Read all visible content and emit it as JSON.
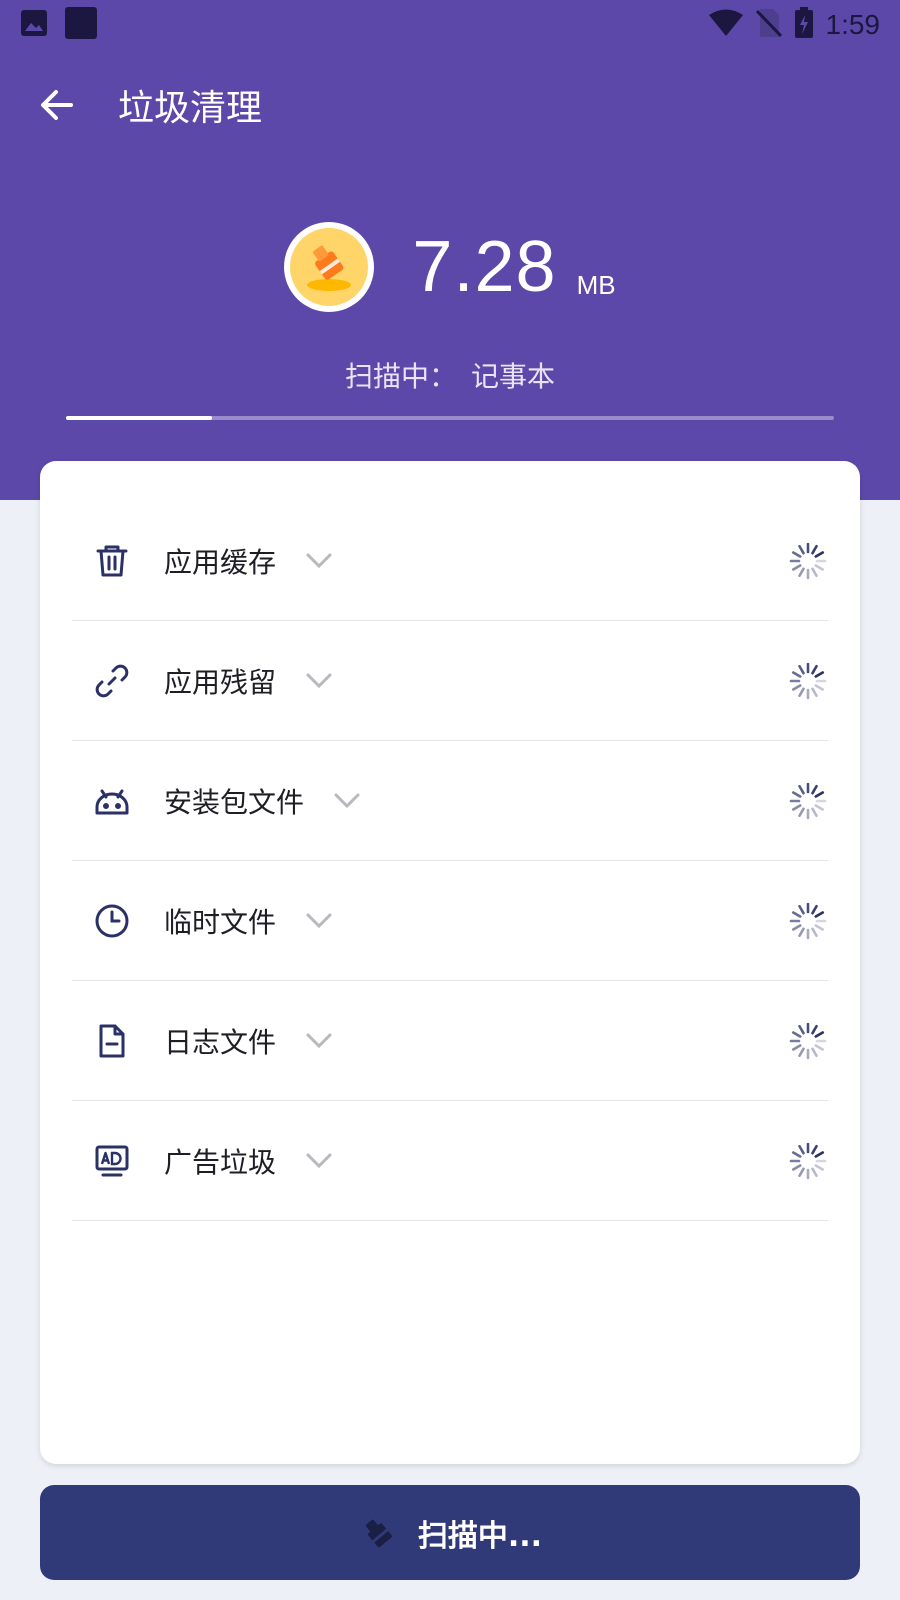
{
  "status_bar": {
    "time": "1:59",
    "icons": [
      "image-icon",
      "sim-icon",
      "wifi-icon",
      "no-sim-icon",
      "battery-charging-icon"
    ]
  },
  "header": {
    "back_icon": "arrow-left-icon",
    "title": "垃圾清理"
  },
  "summary": {
    "icon": "broom-icon",
    "size_value": "7.28",
    "size_unit": "MB",
    "scan_label": "扫描中：",
    "scan_target": "记事本",
    "progress": 0.19
  },
  "categories": [
    {
      "label": "应用缓存",
      "icon": "trash-icon"
    },
    {
      "label": "应用残留",
      "icon": "link-icon"
    },
    {
      "label": "安装包文件",
      "icon": "android-icon"
    },
    {
      "label": "临时文件",
      "icon": "clock-icon"
    },
    {
      "label": "日志文件",
      "icon": "document-icon"
    },
    {
      "label": "广告垃圾",
      "icon": "ad-icon"
    }
  ],
  "action_button": {
    "label": "扫描中...",
    "icon": "broom-icon"
  },
  "colors": {
    "header": "#5c48a8",
    "accent": "#313a78",
    "background": "#eef0f8"
  }
}
